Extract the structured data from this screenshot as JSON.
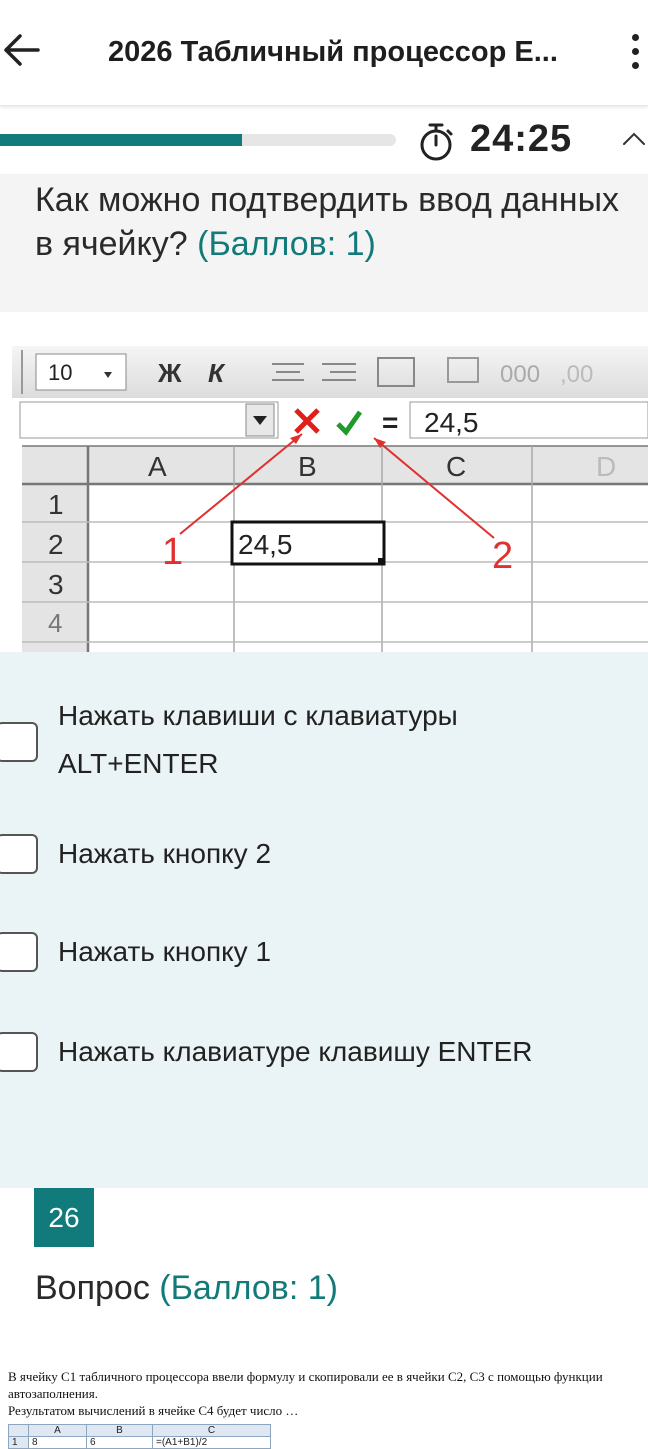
{
  "header": {
    "title": "2026 Табличный процессор  E...",
    "back_icon": "arrow-left-icon",
    "menu_icon": "more-vertical-icon"
  },
  "progress": {
    "fraction": 0.61,
    "timer": "24:25",
    "accent": "#117a7a"
  },
  "question": {
    "text": "Как можно подтвердить ввод данных в ячейку?",
    "points": "(Баллов: 1)"
  },
  "excel": {
    "font_size": "10",
    "bold": "Ж",
    "italic": "К",
    "thousands": "000",
    "decimals": ",00",
    "formula_value": "24,5",
    "equals": "=",
    "columns": [
      "A",
      "B",
      "C",
      "D"
    ],
    "rows": [
      "1",
      "2",
      "3",
      "4"
    ],
    "cell_b2": "24,5",
    "callout_1": "1",
    "callout_2": "2"
  },
  "options": [
    {
      "label": "Нажать клавиши с клавиатуры ALT+ENTER",
      "checked": false
    },
    {
      "label": "Нажать кнопку 2",
      "checked": false
    },
    {
      "label": "Нажать кнопку 1",
      "checked": false
    },
    {
      "label": "Нажать клавиатуре клавишу ENTER",
      "checked": false
    }
  ],
  "next": {
    "number": "26",
    "title": "Вопрос",
    "points": "(Баллов: 1)",
    "line1": "В ячейку C1 табличного процессора ввели формулу и скопировали ее в ячейки C2, C3 с помощью функции автозаполнения.",
    "line2": "Результатом вычислений в ячейке C4 будет число …",
    "table_head": [
      "",
      "A",
      "B",
      "C"
    ],
    "table_row1": [
      "1",
      "8",
      "6",
      "=(A1+B1)/2"
    ]
  }
}
